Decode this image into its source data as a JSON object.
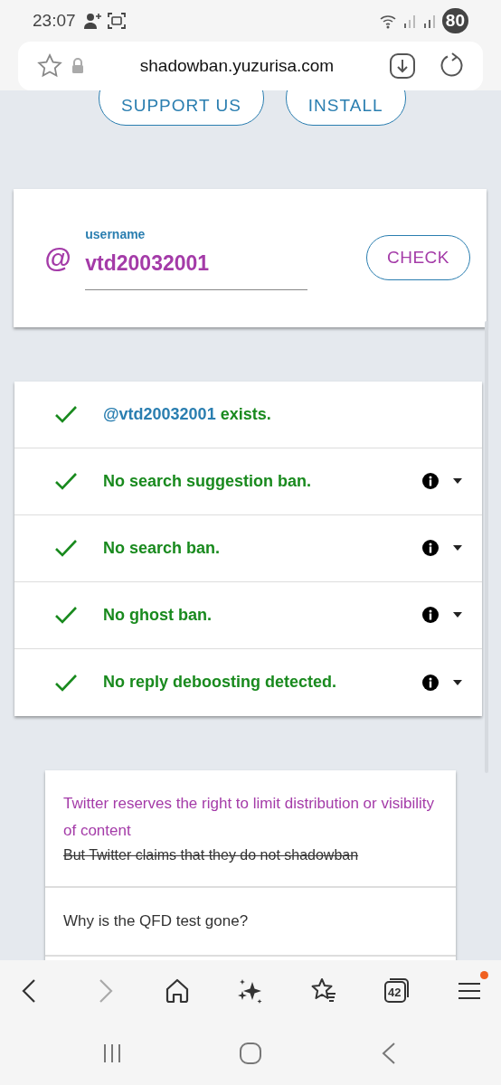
{
  "status_bar": {
    "time": "23:07",
    "battery": "80"
  },
  "address_bar": {
    "url": "shadowban.yuzurisa.com"
  },
  "top_buttons": [
    "SUPPORT US",
    "INSTALL"
  ],
  "search": {
    "prefix": "@",
    "label": "username",
    "value": "vtd20032001",
    "button": "CHECK"
  },
  "results": [
    {
      "kind": "existence",
      "handle": "@vtd20032001",
      "text": "exists.",
      "passed": true
    },
    {
      "kind": "test",
      "text": "No search suggestion ban.",
      "passed": true
    },
    {
      "kind": "test",
      "text": "No search ban.",
      "passed": true
    },
    {
      "kind": "test",
      "text": "No ghost ban.",
      "passed": true
    },
    {
      "kind": "test",
      "text": "No reply deboosting detected.",
      "passed": true
    }
  ],
  "faq": [
    {
      "title": "Twitter reserves the right to limit distribution or visibility of content",
      "struck_note": "But Twitter claims that they do not shadowban"
    },
    {
      "title": "Why is the QFD test gone?"
    }
  ],
  "toolbar": {
    "forward_disabled": true,
    "tab_count": "42",
    "menu_notification": true
  }
}
